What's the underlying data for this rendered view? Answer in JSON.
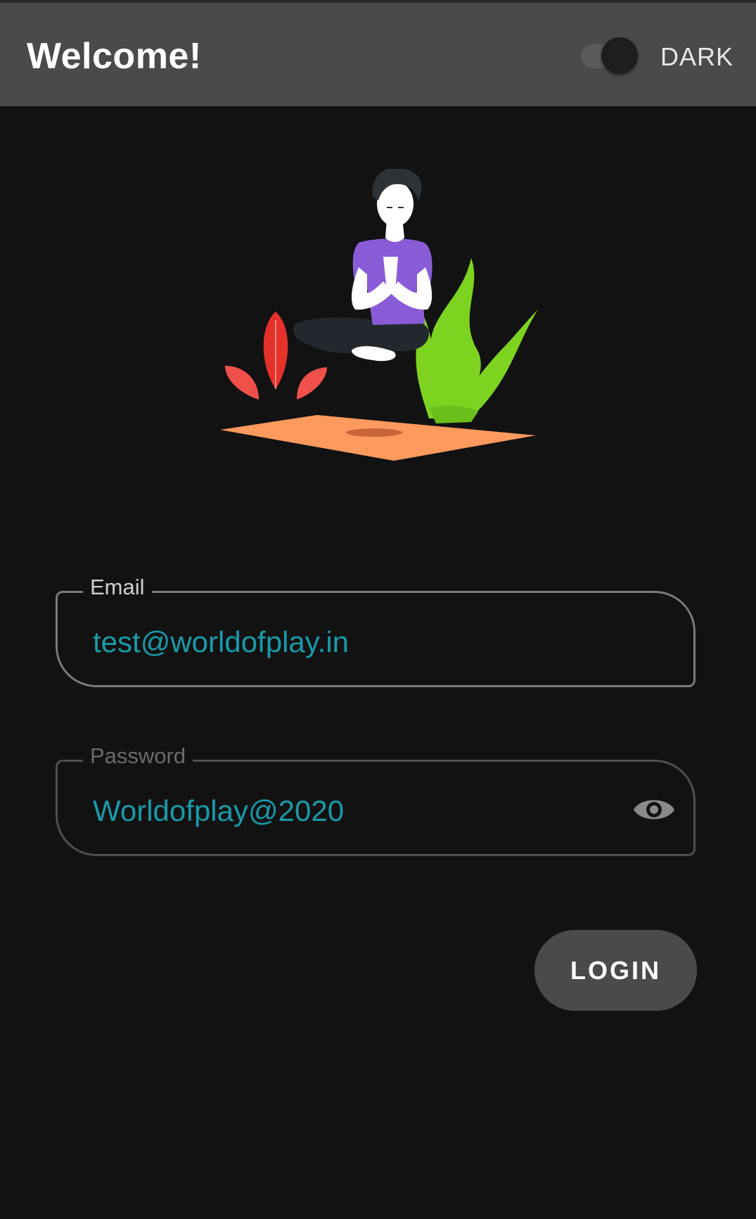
{
  "appbar": {
    "title": "Welcome!",
    "theme_toggle": {
      "label": "DARK",
      "on": true
    }
  },
  "form": {
    "email": {
      "label": "Email",
      "value": "test@worldofplay.in"
    },
    "password": {
      "label": "Password",
      "value": "Worldofplay@2020",
      "toggle_icon": "eye-icon"
    },
    "login_label": "LOGIN"
  },
  "colors": {
    "background": "#121212",
    "appbar": "#4a4a4a",
    "input_text": "#1a9aaa",
    "mat": "#ff9a5e",
    "shirt": "#8a5bd6",
    "leaf_red": "#e4322b",
    "leaf_green": "#7ed321"
  }
}
